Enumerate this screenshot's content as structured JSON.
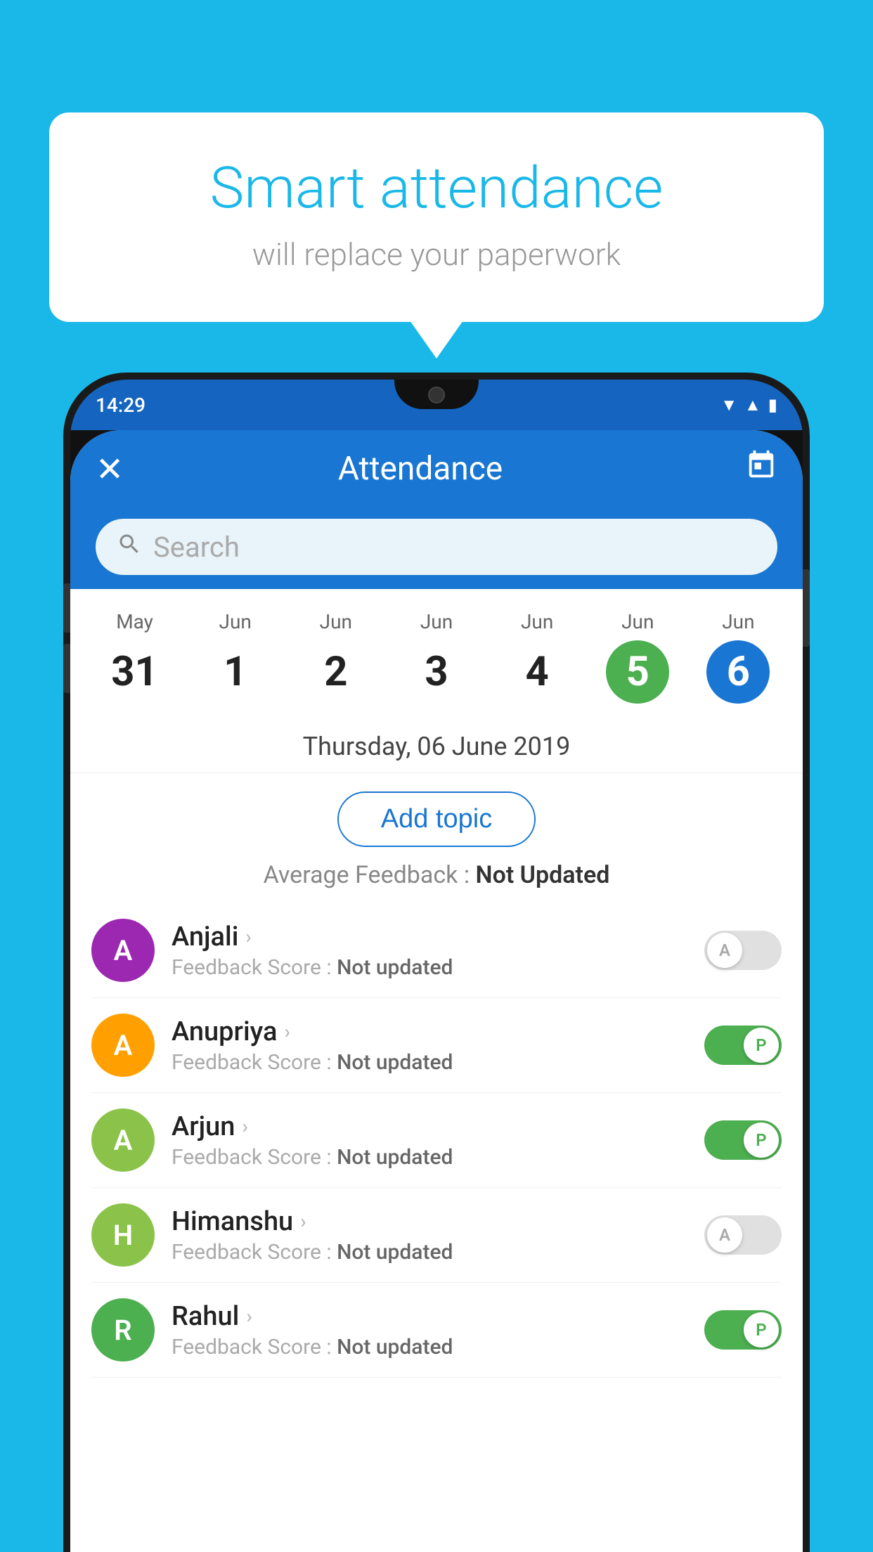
{
  "background_color": "#1ab8e8",
  "speech_bubble": {
    "title": "Smart attendance",
    "subtitle": "will replace your paperwork"
  },
  "status_bar": {
    "time": "14:29",
    "icons": [
      "wifi",
      "signal",
      "battery"
    ]
  },
  "toolbar": {
    "close_icon": "✕",
    "title": "Attendance",
    "calendar_icon": "📅"
  },
  "search": {
    "placeholder": "Search"
  },
  "calendar": {
    "days": [
      {
        "month": "May",
        "date": "31",
        "style": "normal"
      },
      {
        "month": "Jun",
        "date": "1",
        "style": "normal"
      },
      {
        "month": "Jun",
        "date": "2",
        "style": "normal"
      },
      {
        "month": "Jun",
        "date": "3",
        "style": "normal"
      },
      {
        "month": "Jun",
        "date": "4",
        "style": "normal"
      },
      {
        "month": "Jun",
        "date": "5",
        "style": "today"
      },
      {
        "month": "Jun",
        "date": "6",
        "style": "selected"
      }
    ]
  },
  "date_display": "Thursday, 06 June 2019",
  "add_topic_label": "Add topic",
  "avg_feedback_label": "Average Feedback : ",
  "avg_feedback_value": "Not Updated",
  "students": [
    {
      "name": "Anjali",
      "initial": "A",
      "avatar_color": "#9c27b0",
      "feedback_label": "Feedback Score : ",
      "feedback_value": "Not updated",
      "toggle": "off",
      "toggle_letter": "A"
    },
    {
      "name": "Anupriya",
      "initial": "A",
      "avatar_color": "#ffa000",
      "feedback_label": "Feedback Score : ",
      "feedback_value": "Not updated",
      "toggle": "on",
      "toggle_letter": "P"
    },
    {
      "name": "Arjun",
      "initial": "A",
      "avatar_color": "#8bc34a",
      "feedback_label": "Feedback Score : ",
      "feedback_value": "Not updated",
      "toggle": "on",
      "toggle_letter": "P"
    },
    {
      "name": "Himanshu",
      "initial": "H",
      "avatar_color": "#8bc34a",
      "feedback_label": "Feedback Score : ",
      "feedback_value": "Not updated",
      "toggle": "off",
      "toggle_letter": "A"
    },
    {
      "name": "Rahul",
      "initial": "R",
      "avatar_color": "#4caf50",
      "feedback_label": "Feedback Score : ",
      "feedback_value": "Not updated",
      "toggle": "on",
      "toggle_letter": "P"
    }
  ]
}
